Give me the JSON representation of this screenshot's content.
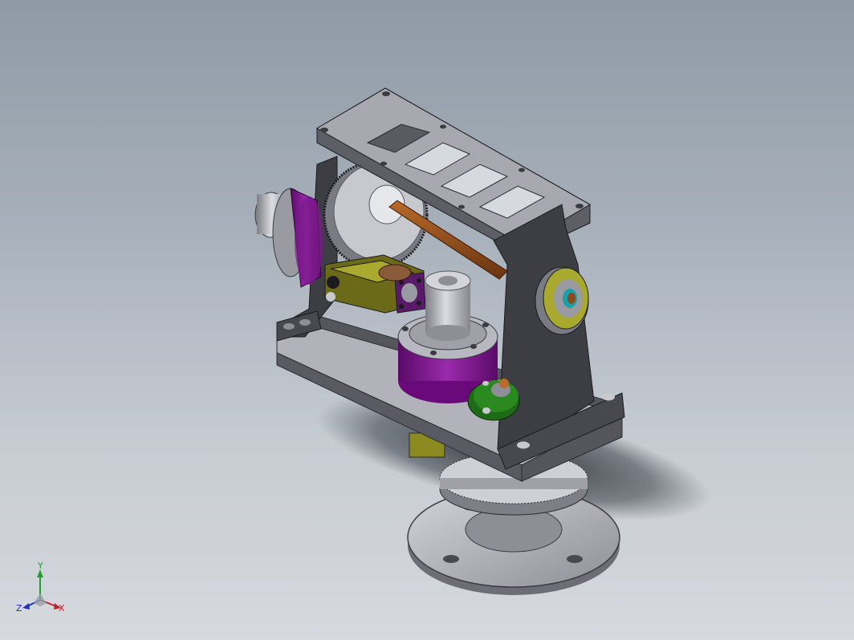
{
  "viewport": {
    "background_top": "#8f9aa6",
    "background_bottom": "#d6d9de"
  },
  "model": {
    "description_icon": "cad-assembly",
    "colors": {
      "steel": "#a9aab0",
      "steel_dark": "#6f7078",
      "bracket": "#4a4b50",
      "motor": "#7a1a8a",
      "gearbox": "#8a8a20",
      "shaft": "#8a4a1a",
      "green_part": "#2a8a20",
      "highlight": "#e2e3e6"
    }
  },
  "triad": {
    "x_label": "X",
    "y_label": "Y",
    "z_label": "Z",
    "x_color": "#c0202a",
    "y_color": "#20a030",
    "z_color": "#2030c0"
  }
}
